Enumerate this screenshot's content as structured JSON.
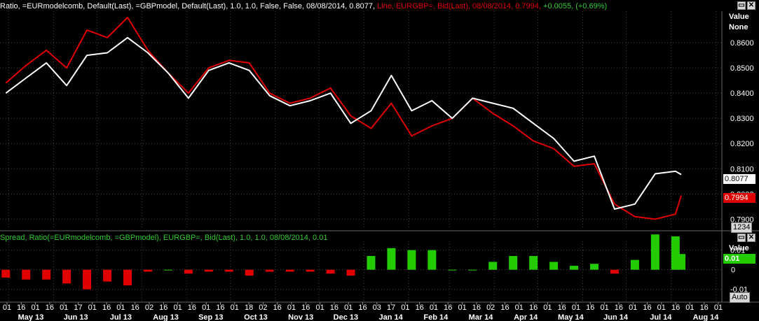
{
  "top_pane": {
    "header_white": "Ratio, =EURmodelcomb, Default(Last), =GBPmodel, Default(Last),  1.0, 1.0, False, False, 08/08/2014, 0.8077,",
    "header_red": "Line, EURGBP=, Bid(Last), 08/08/2014, 0.7994,",
    "header_green": "+0.0055, (+0.69%)",
    "value_label": "Value",
    "value_none": "None",
    "badge_white": "0.8077",
    "badge_red": "0.7994",
    "scale_button": "1234"
  },
  "bottom_pane": {
    "header": "Spread, Ratio(=EURmodelcomb, =GBPmodel), EURGBP=, Bid(Last),  1.0, 1.0, 08/08/2014, 0.01",
    "value_label": "Value",
    "value_badge": "0.01",
    "auto_button": "Auto"
  },
  "controls": {
    "restore_icon": "window-restore-icon",
    "close_icon": "close-icon"
  },
  "colors": {
    "ratio": "#ffffff",
    "eurgbp": "#e00000",
    "spread_pos": "#22cc00",
    "spread_neg": "#e00000",
    "header_green": "#33cc33",
    "grid": "#444444"
  },
  "chart_data": [
    {
      "type": "line",
      "series": [
        {
          "name": "Ratio(=EURmodelcomb, =GBPmodel)",
          "x": [
            "2013-04-29",
            "2013-05-13",
            "2013-05-27",
            "2013-06-10",
            "2013-06-24",
            "2013-07-08",
            "2013-07-22",
            "2013-08-05",
            "2013-08-19",
            "2013-09-02",
            "2013-09-16",
            "2013-09-30",
            "2013-10-14",
            "2013-10-28",
            "2013-11-11",
            "2013-11-25",
            "2013-12-09",
            "2013-12-23",
            "2014-01-06",
            "2014-01-20",
            "2014-02-03",
            "2014-02-17",
            "2014-03-03",
            "2014-03-17",
            "2014-03-31",
            "2014-04-14",
            "2014-04-28",
            "2014-05-12",
            "2014-05-26",
            "2014-06-09",
            "2014-06-23",
            "2014-07-07",
            "2014-07-21",
            "2014-08-04",
            "2014-08-08"
          ],
          "values": [
            0.84,
            0.846,
            0.852,
            0.843,
            0.855,
            0.856,
            0.862,
            0.856,
            0.848,
            0.838,
            0.849,
            0.852,
            0.849,
            0.839,
            0.835,
            0.837,
            0.84,
            0.828,
            0.833,
            0.847,
            0.833,
            0.837,
            0.83,
            0.838,
            0.836,
            0.834,
            0.828,
            0.822,
            0.813,
            0.815,
            0.794,
            0.796,
            0.808,
            0.809,
            0.8077
          ]
        },
        {
          "name": "EURGBP=, Bid(Last)",
          "x": [
            "2013-04-29",
            "2013-05-13",
            "2013-05-27",
            "2013-06-10",
            "2013-06-24",
            "2013-07-08",
            "2013-07-22",
            "2013-08-05",
            "2013-08-19",
            "2013-09-02",
            "2013-09-16",
            "2013-09-30",
            "2013-10-14",
            "2013-10-28",
            "2013-11-11",
            "2013-11-25",
            "2013-12-09",
            "2013-12-23",
            "2014-01-06",
            "2014-01-20",
            "2014-02-03",
            "2014-02-17",
            "2014-03-03",
            "2014-03-17",
            "2014-03-31",
            "2014-04-14",
            "2014-04-28",
            "2014-05-12",
            "2014-05-26",
            "2014-06-09",
            "2014-06-23",
            "2014-07-07",
            "2014-07-21",
            "2014-08-04",
            "2014-08-08"
          ],
          "values": [
            0.844,
            0.851,
            0.857,
            0.85,
            0.865,
            0.862,
            0.87,
            0.857,
            0.848,
            0.84,
            0.85,
            0.853,
            0.852,
            0.84,
            0.836,
            0.838,
            0.842,
            0.831,
            0.826,
            0.836,
            0.823,
            0.827,
            0.83,
            0.838,
            0.832,
            0.827,
            0.821,
            0.818,
            0.811,
            0.812,
            0.796,
            0.791,
            0.79,
            0.792,
            0.7994
          ]
        }
      ],
      "ylim": [
        0.7865,
        0.8725
      ],
      "yticks": [
        0.79,
        0.8,
        0.81,
        0.82,
        0.83,
        0.84,
        0.85,
        0.86
      ],
      "ytick_labels": [
        "0.7900",
        "0.8000",
        "0.8100",
        "0.8200",
        "0.8300",
        "0.8400",
        "0.8500",
        "0.8600"
      ],
      "grid": true
    },
    {
      "type": "bar",
      "series": [
        {
          "name": "Spread",
          "x": [
            "2013-04-29",
            "2013-05-13",
            "2013-05-27",
            "2013-06-10",
            "2013-06-24",
            "2013-07-08",
            "2013-07-22",
            "2013-08-05",
            "2013-08-19",
            "2013-09-02",
            "2013-09-16",
            "2013-09-30",
            "2013-10-14",
            "2013-10-28",
            "2013-11-11",
            "2013-11-25",
            "2013-12-09",
            "2013-12-23",
            "2014-01-06",
            "2014-01-20",
            "2014-02-03",
            "2014-02-17",
            "2014-03-03",
            "2014-03-17",
            "2014-03-31",
            "2014-04-14",
            "2014-04-28",
            "2014-05-12",
            "2014-05-26",
            "2014-06-09",
            "2014-06-23",
            "2014-07-07",
            "2014-07-21",
            "2014-08-04",
            "2014-08-08"
          ],
          "values": [
            -0.004,
            -0.005,
            -0.005,
            -0.007,
            -0.01,
            -0.006,
            -0.008,
            -0.001,
            0.0,
            -0.002,
            -0.001,
            -0.001,
            -0.003,
            -0.001,
            -0.001,
            -0.001,
            -0.002,
            -0.003,
            0.007,
            0.011,
            0.01,
            0.01,
            0.0,
            0.0,
            0.004,
            0.007,
            0.007,
            0.004,
            0.002,
            0.003,
            -0.002,
            0.005,
            0.018,
            0.017,
            0.008
          ]
        }
      ],
      "ylim": [
        -0.0158,
        0.0145
      ],
      "yticks": [
        -0.01,
        0.0,
        0.01
      ],
      "ytick_labels": [
        "-0.01",
        "0",
        "0.01"
      ],
      "grid": true
    }
  ],
  "x_axis": {
    "day_labels": [
      "01",
      "16",
      "01",
      "16",
      "01",
      "17",
      "01",
      "16",
      "01",
      "16",
      "02",
      "16",
      "01",
      "16",
      "01",
      "16",
      "01",
      "18",
      "02",
      "16",
      "01",
      "16",
      "01",
      "16",
      "01",
      "16",
      "03",
      "17",
      "01",
      "16",
      "01",
      "16",
      "01",
      "16",
      "02",
      "16",
      "01",
      "16",
      "01",
      "16",
      "01",
      "16",
      "01",
      "16",
      "01",
      "16",
      "01",
      "16",
      "01",
      "16",
      "01"
    ],
    "month_labels": [
      "May 13",
      "Jun 13",
      "Jul 13",
      "Aug 13",
      "Sep 13",
      "Oct 13",
      "Nov 13",
      "Dec 13",
      "Jan 14",
      "Feb 14",
      "Mar 14",
      "Apr 14",
      "May 14",
      "Jun 14",
      "Jul 14",
      "Aug 14"
    ]
  }
}
